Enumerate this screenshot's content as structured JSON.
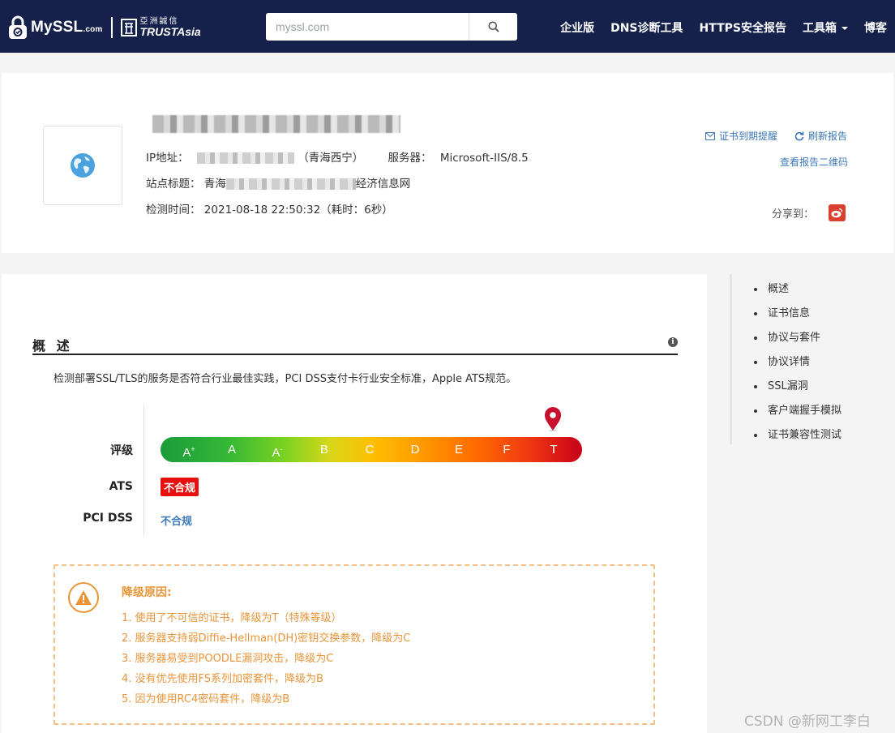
{
  "header": {
    "brand": "MySSL",
    "brand_suffix": ".com",
    "partner_cn": "亞洲誠信",
    "partner_en": "TRUSTAsia",
    "search_placeholder": "myssl.com",
    "nav": [
      "企业版",
      "DNS诊断工具",
      "HTTPS安全报告",
      "工具箱",
      "博客"
    ]
  },
  "site": {
    "ip_label": "IP地址：",
    "ip_location": "（青海西宁）",
    "server_label": "服务器：",
    "server_value": "Microsoft-IIS/8.5",
    "title_label": "站点标题：",
    "title_prefix": "青海",
    "title_suffix": "经济信息网",
    "time_label": "检测时间：",
    "time_value": "2021-08-18 22:50:32（耗时：6秒）",
    "actions": {
      "cert_reminder": "证书到期提醒",
      "refresh": "刷新报告",
      "qrcode": "查看报告二维码"
    },
    "share_label": "分享到："
  },
  "overview": {
    "title": "概 述",
    "description": "检测部署SSL/TLS的服务是否符合行业最佳实践，PCI DSS支付卡行业安全标准，Apple ATS规范。",
    "rating_label": "评级",
    "grades": [
      "A+",
      "A",
      "A-",
      "B",
      "C",
      "D",
      "E",
      "F",
      "T"
    ],
    "current_grade": "T",
    "ats_label": "ATS",
    "ats_value": "不合规",
    "pci_label": "PCI DSS",
    "pci_value": "不合规",
    "downgrade_title": "降级原因:",
    "downgrade_reasons": [
      "1. 使用了不可信的证书，降级为T（特殊等级）",
      "2. 服务器支持弱Diffie-Hellman(DH)密钥交换参数，降级为C",
      "3. 服务器易受到POODLE漏洞攻击，降级为C",
      "4. 没有优先使用FS系列加密套件，降级为B",
      "5. 因为使用RC4密码套件，降级为B"
    ]
  },
  "toc": [
    "概述",
    "证书信息",
    "协议与套件",
    "协议详情",
    "SSL漏洞",
    "客户端握手模拟",
    "证书兼容性测试"
  ],
  "watermark": "CSDN @新网工李白",
  "colors": {
    "header_bg": "#15204b",
    "link": "#3d78b8",
    "warning": "#e8953a",
    "danger": "#e8100c"
  }
}
